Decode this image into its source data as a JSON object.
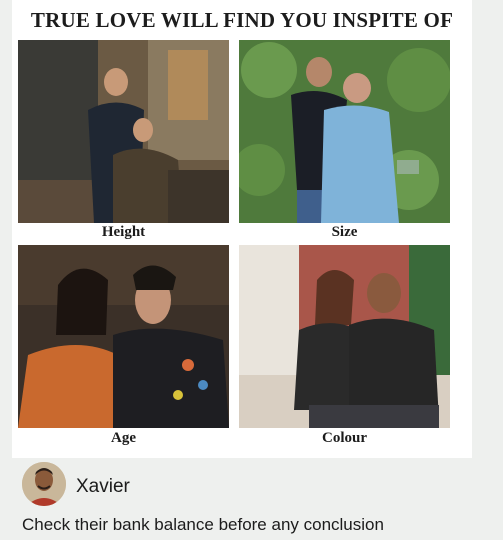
{
  "meme": {
    "title": "TRUE LOVE WILL FIND YOU INSPITE OF",
    "panels": [
      {
        "caption": "Height"
      },
      {
        "caption": "Size"
      },
      {
        "caption": "Age"
      },
      {
        "caption": "Colour"
      }
    ]
  },
  "comment": {
    "author": "Xavier",
    "text": "Check their bank balance before any conclusion"
  }
}
